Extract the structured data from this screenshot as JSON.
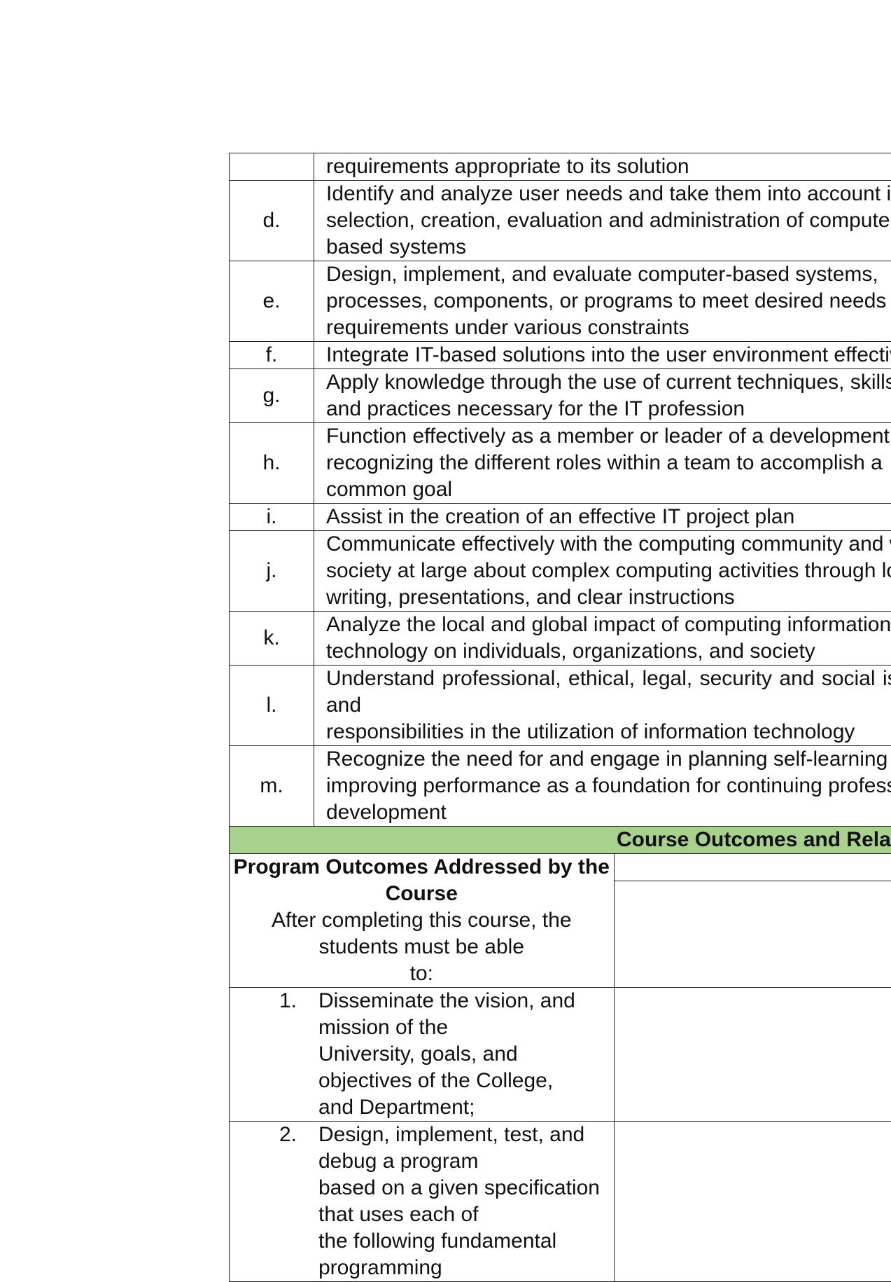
{
  "program_outcomes": [
    {
      "letter": "",
      "lines": [
        "requirements appropriate to its solution"
      ]
    },
    {
      "letter": "d.",
      "lines": [
        "Identify and analyze user needs and take them into account in the",
        "selection, creation, evaluation and administration of computer-",
        "based systems"
      ]
    },
    {
      "letter": "e.",
      "lines": [
        "Design, implement, and evaluate computer-based systems,",
        "processes, components, or programs to meet desired needs and",
        "requirements under various constraints"
      ]
    },
    {
      "letter": "f.",
      "lines": [
        "Integrate IT-based solutions into the user environment effectively"
      ]
    },
    {
      "letter": "g.",
      "lines": [
        "Apply knowledge through the use of current techniques, skills, tools",
        "and practices necessary for the IT profession"
      ]
    },
    {
      "letter": "h.",
      "lines": [
        "Function effectively as a member or leader of a development team",
        "recognizing the different roles within a team to accomplish a",
        "common goal"
      ]
    },
    {
      "letter": "i.",
      "lines": [
        "Assist in the creation of an effective IT project plan"
      ]
    },
    {
      "letter": "j.",
      "lines": [
        "Communicate effectively with the computing community and with",
        "society at large about complex computing activities through logical",
        "writing, presentations, and clear instructions"
      ]
    },
    {
      "letter": "k.",
      "lines": [
        "Analyze the local and global impact of computing information",
        "technology on individuals, organizations, and society"
      ]
    },
    {
      "letter": "l.",
      "lines": [
        "Understand professional, ethical, legal, security and social issues",
        "and",
        "responsibilities in the utilization of information technology"
      ]
    },
    {
      "letter": "m.",
      "lines": [
        "Recognize the need for and engage in planning self-learning and",
        "improving performance as a foundation for continuing professional",
        "development"
      ]
    }
  ],
  "course_outcomes": {
    "section_title": "Course Outcomes and Relationship to Program Outcomes",
    "header_bold": "Program Outcomes Addressed by the Course",
    "header_line1": "After completing this course, the students must be able",
    "header_line2": "to:",
    "items": [
      {
        "num": "1.",
        "lines": [
          "Disseminate the vision, and mission of the",
          "University, goals, and objectives of the College,",
          "and Department;"
        ]
      },
      {
        "num": "2.",
        "lines": [
          "Design, implement, test, and debug a program",
          "based on a given specification that uses each of",
          "the following fundamental programming"
        ]
      }
    ]
  }
}
